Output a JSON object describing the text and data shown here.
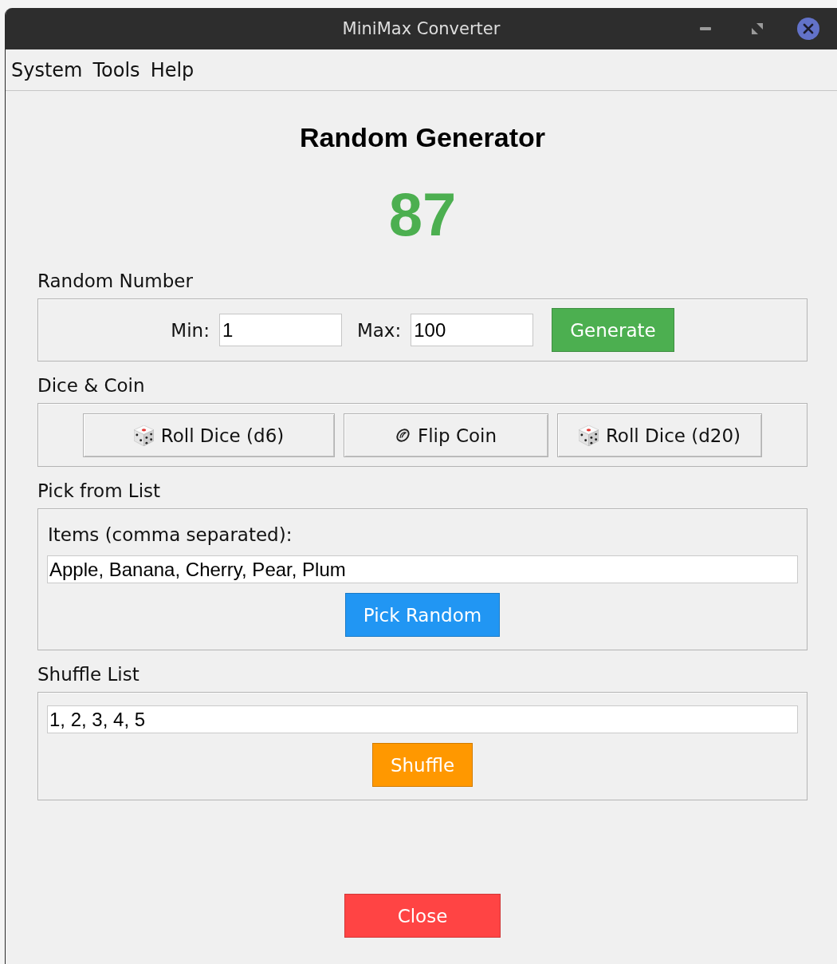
{
  "window": {
    "title": "MiniMax Converter"
  },
  "menu": [
    {
      "label": "System"
    },
    {
      "label": "Tools"
    },
    {
      "label": "Help"
    }
  ],
  "heading": "Random Generator",
  "result": "87",
  "sections": [
    {
      "kind": "range",
      "title": "Random Number",
      "fields": [
        {
          "label": "Min:",
          "value": "1"
        },
        {
          "label": "Max:",
          "value": "100"
        }
      ],
      "action": {
        "label": "Generate",
        "color": "#4caf50"
      }
    },
    {
      "kind": "buttons",
      "title": "Dice & Coin",
      "buttons": [
        {
          "kind": "dice",
          "label": "Roll Dice (d6)"
        },
        {
          "kind": "coin",
          "label": "Flip Coin"
        },
        {
          "kind": "dice",
          "label": "Roll Dice (d20)"
        }
      ]
    },
    {
      "kind": "list",
      "title": "Pick from List",
      "label": "Items (comma separated):",
      "value": "Apple, Banana, Cherry, Pear, Plum",
      "action": {
        "label": "Pick Random",
        "color": "#2196f3"
      }
    },
    {
      "kind": "list",
      "title": "Shuffle List",
      "value": "1, 2, 3, 4, 5",
      "action": {
        "label": "Shuffle",
        "color": "#ff9800"
      }
    }
  ],
  "close_button": {
    "label": "Close",
    "color": "#ff4444"
  }
}
